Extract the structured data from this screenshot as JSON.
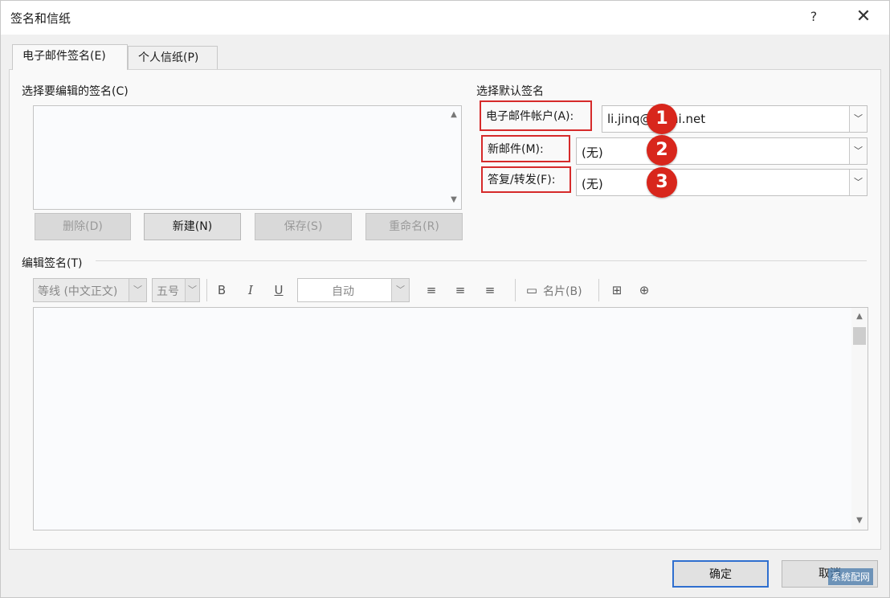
{
  "window": {
    "title": "签名和信纸",
    "help": "?",
    "close": "✕"
  },
  "tabs": [
    {
      "label": "电子邮件签名(E)"
    },
    {
      "label": "个人信纸(P)"
    }
  ],
  "signatures": {
    "section_label": "选择要编辑的签名(C)",
    "buttons": {
      "delete": "删除(D)",
      "new": "新建(N)",
      "save": "保存(S)",
      "rename": "重命名(R)"
    }
  },
  "defaults": {
    "section_label": "选择默认签名",
    "account_label": "电子邮件帐户(A):",
    "account_value": "li.jinq@      mini.net",
    "new_messages_label": "新邮件(M):",
    "new_messages_value": "(无)",
    "replies_label": "答复/转发(F):",
    "replies_value": "(无)"
  },
  "editor": {
    "section_label": "编辑签名(T)",
    "font": "等线 (中文正文)",
    "size": "五号",
    "bold": "B",
    "italic": "I",
    "underline": "U",
    "color": "自动",
    "business_card": "名片(B)"
  },
  "badges": [
    "1",
    "2",
    "3"
  ],
  "footer": {
    "ok": "确定",
    "cancel": "取消"
  },
  "watermark": "系统配网",
  "colors": {
    "badge": "#d8261c",
    "highlight_box": "#d62a2a"
  }
}
